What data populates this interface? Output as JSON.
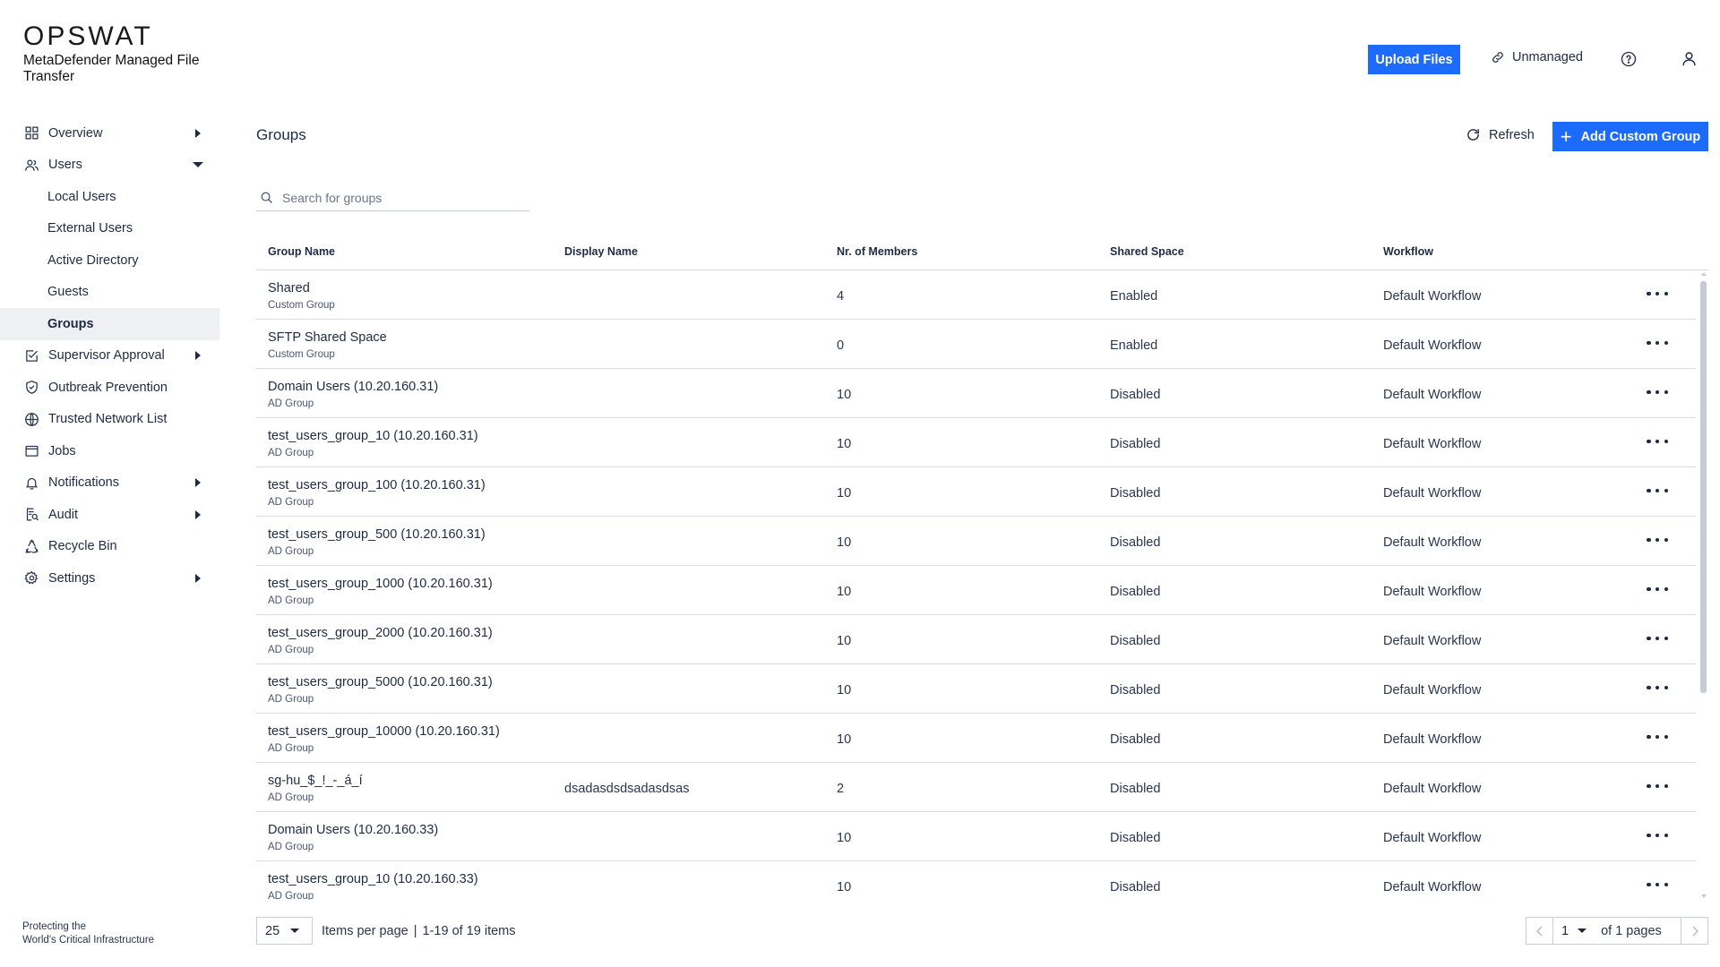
{
  "brand": {
    "logo": "OPSWAT",
    "product": "MetaDefender Managed File Transfer",
    "tagline_line1": "Protecting the",
    "tagline_line2": "World's Critical Infrastructure"
  },
  "sidebar": {
    "items": [
      {
        "label": "Overview",
        "icon": "dashboard-icon",
        "arrow": "right"
      },
      {
        "label": "Users",
        "icon": "users-icon",
        "arrow": "down"
      }
    ],
    "users_sub": [
      {
        "label": "Local Users"
      },
      {
        "label": "External Users"
      },
      {
        "label": "Active Directory"
      },
      {
        "label": "Guests"
      },
      {
        "label": "Groups",
        "active": true
      }
    ],
    "items_after": [
      {
        "label": "Supervisor Approval",
        "icon": "approval-icon",
        "arrow": "right"
      },
      {
        "label": "Outbreak Prevention",
        "icon": "shield-icon"
      },
      {
        "label": "Trusted Network List",
        "icon": "globe-icon"
      },
      {
        "label": "Jobs",
        "icon": "jobs-icon"
      },
      {
        "label": "Notifications",
        "icon": "bell-icon",
        "arrow": "right"
      },
      {
        "label": "Audit",
        "icon": "audit-icon",
        "arrow": "right"
      },
      {
        "label": "Recycle Bin",
        "icon": "recycle-icon"
      },
      {
        "label": "Settings",
        "icon": "gear-icon",
        "arrow": "right"
      }
    ]
  },
  "header": {
    "upload_label": "Upload Files",
    "unmanaged_label": "Unmanaged"
  },
  "page": {
    "title": "Groups",
    "refresh_label": "Refresh",
    "add_label": "Add Custom Group",
    "search_placeholder": "Search for groups"
  },
  "table": {
    "columns": [
      "Group Name",
      "Display Name",
      "Nr. of Members",
      "Shared Space",
      "Workflow"
    ],
    "rows": [
      {
        "name": "Shared",
        "type": "Custom Group",
        "display": "",
        "members": "4",
        "shared": "Enabled",
        "workflow": "Default Workflow"
      },
      {
        "name": "SFTP Shared Space",
        "type": "Custom Group",
        "display": "",
        "members": "0",
        "shared": "Enabled",
        "workflow": "Default Workflow"
      },
      {
        "name": "Domain Users (10.20.160.31)",
        "type": "AD Group",
        "display": "",
        "members": "10",
        "shared": "Disabled",
        "workflow": "Default Workflow"
      },
      {
        "name": "test_users_group_10 (10.20.160.31)",
        "type": "AD Group",
        "display": "",
        "members": "10",
        "shared": "Disabled",
        "workflow": "Default Workflow"
      },
      {
        "name": "test_users_group_100 (10.20.160.31)",
        "type": "AD Group",
        "display": "",
        "members": "10",
        "shared": "Disabled",
        "workflow": "Default Workflow"
      },
      {
        "name": "test_users_group_500 (10.20.160.31)",
        "type": "AD Group",
        "display": "",
        "members": "10",
        "shared": "Disabled",
        "workflow": "Default Workflow"
      },
      {
        "name": "test_users_group_1000 (10.20.160.31)",
        "type": "AD Group",
        "display": "",
        "members": "10",
        "shared": "Disabled",
        "workflow": "Default Workflow"
      },
      {
        "name": "test_users_group_2000 (10.20.160.31)",
        "type": "AD Group",
        "display": "",
        "members": "10",
        "shared": "Disabled",
        "workflow": "Default Workflow"
      },
      {
        "name": "test_users_group_5000 (10.20.160.31)",
        "type": "AD Group",
        "display": "",
        "members": "10",
        "shared": "Disabled",
        "workflow": "Default Workflow"
      },
      {
        "name": "test_users_group_10000 (10.20.160.31)",
        "type": "AD Group",
        "display": "",
        "members": "10",
        "shared": "Disabled",
        "workflow": "Default Workflow"
      },
      {
        "name": "sg-hu_$_!_-_á_í",
        "type": "AD Group",
        "display": "dsadasdsdsadasdsas",
        "members": "2",
        "shared": "Disabled",
        "workflow": "Default Workflow"
      },
      {
        "name": "Domain Users (10.20.160.33)",
        "type": "AD Group",
        "display": "",
        "members": "10",
        "shared": "Disabled",
        "workflow": "Default Workflow"
      },
      {
        "name": "test_users_group_10 (10.20.160.33)",
        "type": "AD Group",
        "display": "",
        "members": "10",
        "shared": "Disabled",
        "workflow": "Default Workflow"
      }
    ]
  },
  "pagination": {
    "per_page": "25",
    "per_page_label": "Items per page",
    "separator": "|",
    "range_label": "1-19 of 19 items",
    "current_page": "1",
    "of_pages": "of 1 pages"
  },
  "colors": {
    "accent": "#1d6bfd",
    "active_bg": "#eef0f3",
    "border": "#d9dde3"
  }
}
